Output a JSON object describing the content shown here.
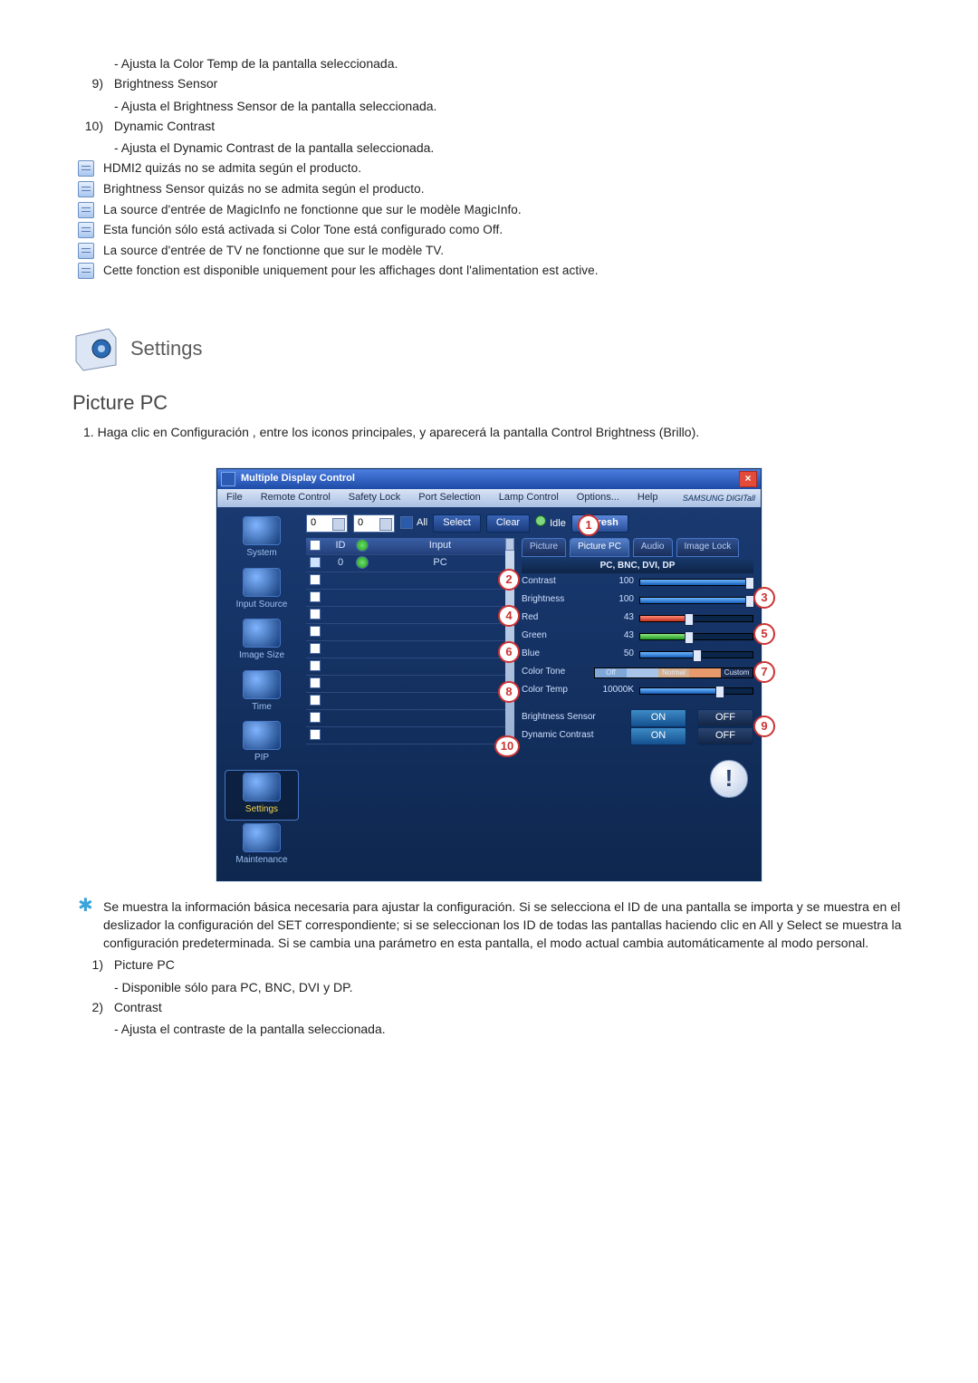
{
  "prelist": {
    "sub8": "- Ajusta la Color Temp de la pantalla seleccionada.",
    "n9": "9)",
    "l9": "Brightness Sensor",
    "s9": "- Ajusta el Brightness Sensor de la pantalla seleccionada.",
    "n10": "10)",
    "l10": "Dynamic Contrast",
    "s10": "- Ajusta el Dynamic Contrast de la pantalla seleccionada."
  },
  "notes": [
    "HDMI2 quizás no se admita según el producto.",
    "Brightness Sensor quizás no se admita según el producto.",
    "La source d'entrée de MagicInfo ne fonctionne que sur le modèle MagicInfo.",
    "Esta función sólo está activada si Color Tone está configurado como Off.",
    "La source d'entrée de TV ne fonctionne que sur le modèle TV.",
    "Cette fonction est disponible uniquement pour les affichages dont l'alimentation est active."
  ],
  "heading": "Settings",
  "subheading": "Picture PC",
  "intro_num": "1.",
  "intro": "Haga clic en Configuración , entre los iconos principales, y aparecerá la pantalla Control Brightness (Brillo).",
  "shot": {
    "title": "Multiple Display Control",
    "menus": [
      "File",
      "Remote Control",
      "Safety Lock",
      "Port Selection",
      "Lamp Control",
      "Options...",
      "Help"
    ],
    "brand": "SAMSUNG DIGITall",
    "sidebar": [
      {
        "label": "System",
        "sel": false
      },
      {
        "label": "Input Source",
        "sel": false
      },
      {
        "label": "Image Size",
        "sel": false
      },
      {
        "label": "Time",
        "sel": false
      },
      {
        "label": "PIP",
        "sel": false
      },
      {
        "label": "Settings",
        "sel": true
      },
      {
        "label": "Maintenance",
        "sel": false
      }
    ],
    "top": {
      "d1": "0",
      "d2": "0",
      "all": "All",
      "select": "Select",
      "clear": "Clear",
      "idle": "Idle",
      "refresh": "Refresh"
    },
    "tbl_head": {
      "c": "",
      "id": "ID",
      "st": "",
      "in": "Input"
    },
    "tbl_row": {
      "id": "0",
      "in": "PC"
    },
    "tabs": [
      "Picture",
      "Picture PC",
      "Audio",
      "Image Lock"
    ],
    "panel_head": "PC, BNC, DVI, DP",
    "params": [
      {
        "label": "Contrast",
        "val": "100",
        "pct": 100,
        "col": "blue"
      },
      {
        "label": "Brightness",
        "val": "100",
        "pct": 100,
        "col": "blue"
      },
      {
        "label": "Red",
        "val": "43",
        "pct": 43,
        "col": "red"
      },
      {
        "label": "Green",
        "val": "43",
        "pct": 43,
        "col": "green"
      },
      {
        "label": "Blue",
        "val": "50",
        "pct": 50,
        "col": "blue"
      }
    ],
    "colortone": {
      "label": "Color Tone",
      "segs": [
        "Off",
        "",
        "Normal",
        "",
        "Custom"
      ]
    },
    "colortemp": {
      "label": "Color Temp",
      "val": "10000K"
    },
    "bsensor": {
      "label": "Brightness Sensor",
      "on": "ON",
      "off": "OFF"
    },
    "dcontrast": {
      "label": "Dynamic Contrast",
      "on": "ON",
      "off": "OFF"
    },
    "calls": [
      "1",
      "2",
      "3",
      "4",
      "5",
      "6",
      "7",
      "8",
      "9",
      "10"
    ]
  },
  "star": "Se muestra la información básica necesaria para ajustar la configuración. Si se selecciona el ID de una pantalla se importa y se muestra en el deslizador la configuración del SET correspondiente; si se seleccionan los ID de todas las pantallas haciendo clic en All y Select se muestra la configuración predeterminada. Si se cambia una parámetro en esta pantalla, el modo actual cambia automáticamente al modo personal.",
  "post": {
    "n1": "1)",
    "l1": "Picture PC",
    "s1": "- Disponible sólo para PC, BNC, DVI y DP.",
    "n2": "2)",
    "l2": "Contrast",
    "s2": "- Ajusta el contraste de la pantalla seleccionada."
  }
}
